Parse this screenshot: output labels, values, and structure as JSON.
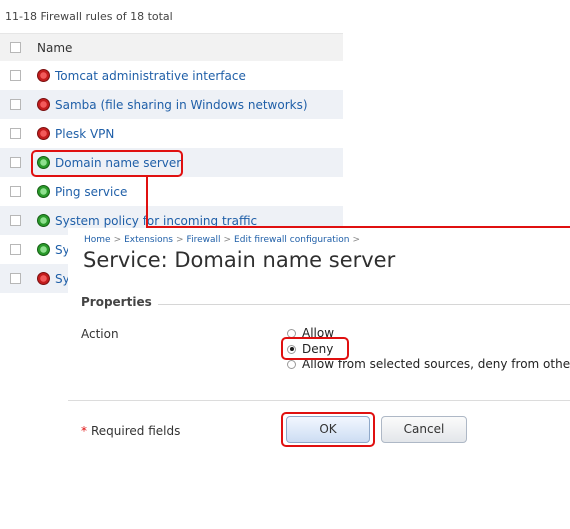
{
  "rules_list": {
    "summary": "11-18 Firewall rules of 18 total",
    "column_name": "Name",
    "rows": [
      {
        "label": "Tomcat administrative interface",
        "status": "red"
      },
      {
        "label": "Samba (file sharing in Windows networks)",
        "status": "red"
      },
      {
        "label": "Plesk VPN",
        "status": "red"
      },
      {
        "label": "Domain name server",
        "status": "green"
      },
      {
        "label": "Ping service",
        "status": "green"
      },
      {
        "label": "System policy for incoming traffic",
        "status": "green"
      },
      {
        "label": "Sy",
        "status": "green"
      },
      {
        "label": "Sy",
        "status": "red"
      }
    ]
  },
  "breadcrumb": [
    "Home",
    "Extensions",
    "Firewall",
    "Edit firewall configuration"
  ],
  "breadcrumb_separator": ">",
  "page_title": "Service: Domain name server",
  "properties": {
    "legend": "Properties",
    "action_label": "Action",
    "options": [
      {
        "label": "Allow",
        "selected": false
      },
      {
        "label": "Deny",
        "selected": true
      },
      {
        "label": "Allow from selected sources, deny from others",
        "selected": false
      }
    ]
  },
  "form": {
    "required_star": "*",
    "required_label": "Required fields",
    "ok_label": "OK",
    "cancel_label": "Cancel"
  },
  "colors": {
    "link": "#1f5fa8",
    "callout": "#e01010",
    "status_on": "#2a9a2a",
    "status_off": "#c31d1d"
  }
}
